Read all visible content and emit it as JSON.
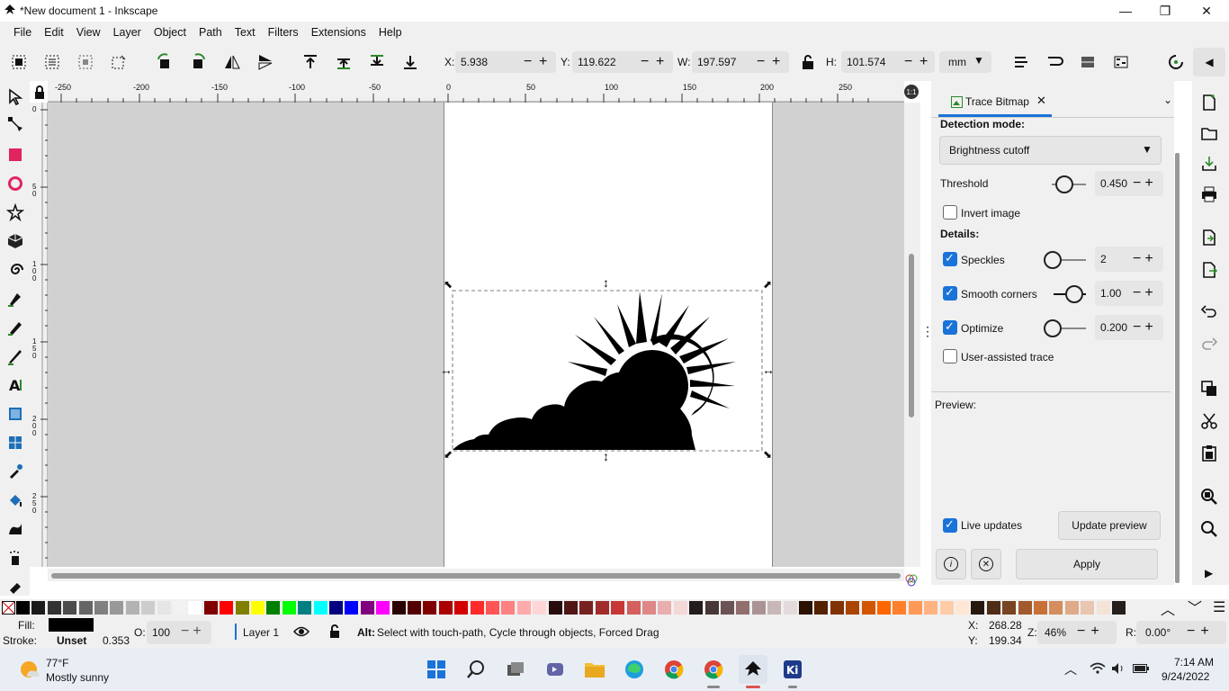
{
  "window": {
    "title": "*New document 1 - Inkscape"
  },
  "menu": [
    "File",
    "Edit",
    "View",
    "Layer",
    "Object",
    "Path",
    "Text",
    "Filters",
    "Extensions",
    "Help"
  ],
  "toolbar": {
    "x_label": "X:",
    "x_value": "5.938",
    "y_label": "Y:",
    "y_value": "119.622",
    "w_label": "W:",
    "w_value": "197.597",
    "h_label": "H:",
    "h_value": "101.574",
    "unit": "mm"
  },
  "ruler": {
    "h_ticks": [
      "-250",
      "-200",
      "-150",
      "-100",
      "-50",
      "0",
      "50",
      "100",
      "150",
      "200",
      "250"
    ],
    "v_ticks": [
      "0",
      "50",
      "100",
      "150",
      "200",
      "250"
    ]
  },
  "dock": {
    "tab_label": "Trace Bitmap",
    "detection_mode_label": "Detection mode:",
    "detection_mode_value": "Brightness cutoff",
    "threshold_label": "Threshold",
    "threshold_value": "0.450",
    "invert_label": "Invert image",
    "details_label": "Details:",
    "speckles_label": "Speckles",
    "speckles_value": "2",
    "smooth_label": "Smooth corners",
    "smooth_value": "1.00",
    "optimize_label": "Optimize",
    "optimize_value": "0.200",
    "user_assisted_label": "User-assisted trace",
    "preview_label": "Preview:",
    "live_updates_label": "Live updates",
    "update_preview_label": "Update preview",
    "apply_label": "Apply"
  },
  "status": {
    "fill_label": "Fill:",
    "stroke_label": "Stroke:",
    "stroke_value": "Unset",
    "stroke_width": "0.353",
    "opacity_label": "O:",
    "opacity_value": "100",
    "layer_name": "Layer 1",
    "message_bold": "Alt:",
    "message": "Select with touch-path, Cycle through objects, Forced Drag",
    "cursor_x_label": "X:",
    "cursor_x": "268.28",
    "cursor_y_label": "Y:",
    "cursor_y": "199.34",
    "zoom_label": "Z:",
    "zoom": "46%",
    "rotation_label": "R:",
    "rotation": "0.00°"
  },
  "taskbar": {
    "weather_temp": "77°F",
    "weather_desc": "Mostly sunny",
    "time": "7:14 AM",
    "date": "9/24/2022"
  },
  "colors": {
    "accent": "#1a73d9",
    "palette": [
      "#000000",
      "#1a1a1a",
      "#333333",
      "#4d4d4d",
      "#666666",
      "#808080",
      "#999999",
      "#b3b3b3",
      "#cccccc",
      "#e6e6e6",
      "#f2f2f2",
      "#ffffff",
      "#800000",
      "#ff0000",
      "#808000",
      "#ffff00",
      "#008000",
      "#00ff00",
      "#008080",
      "#00ffff",
      "#000080",
      "#0000ff",
      "#800080",
      "#ff00ff",
      "#2b0000",
      "#550000",
      "#800000",
      "#aa0000",
      "#d40000",
      "#ff2a2a",
      "#ff5555",
      "#ff8080",
      "#ffaaaa",
      "#ffd5d5",
      "#280b0b",
      "#501616",
      "#782121",
      "#a02c2c",
      "#c83737",
      "#d35f5f",
      "#de8787",
      "#e9afaf",
      "#f4d7d7",
      "#241c1c",
      "#483737",
      "#6c5353",
      "#916f6f",
      "#ac9393",
      "#c8b7b7",
      "#e3dbdb",
      "#2b1100",
      "#552200",
      "#803300",
      "#aa4400",
      "#d45500",
      "#ff6600",
      "#ff7f2a",
      "#ff9955",
      "#ffb380",
      "#ffccaa",
      "#ffe6d5",
      "#28170b",
      "#502d16",
      "#784421",
      "#a05a2c",
      "#c87137",
      "#d38d5f",
      "#deaa87",
      "#e9c6af",
      "#f4e3d7",
      "#241f1c"
    ]
  }
}
